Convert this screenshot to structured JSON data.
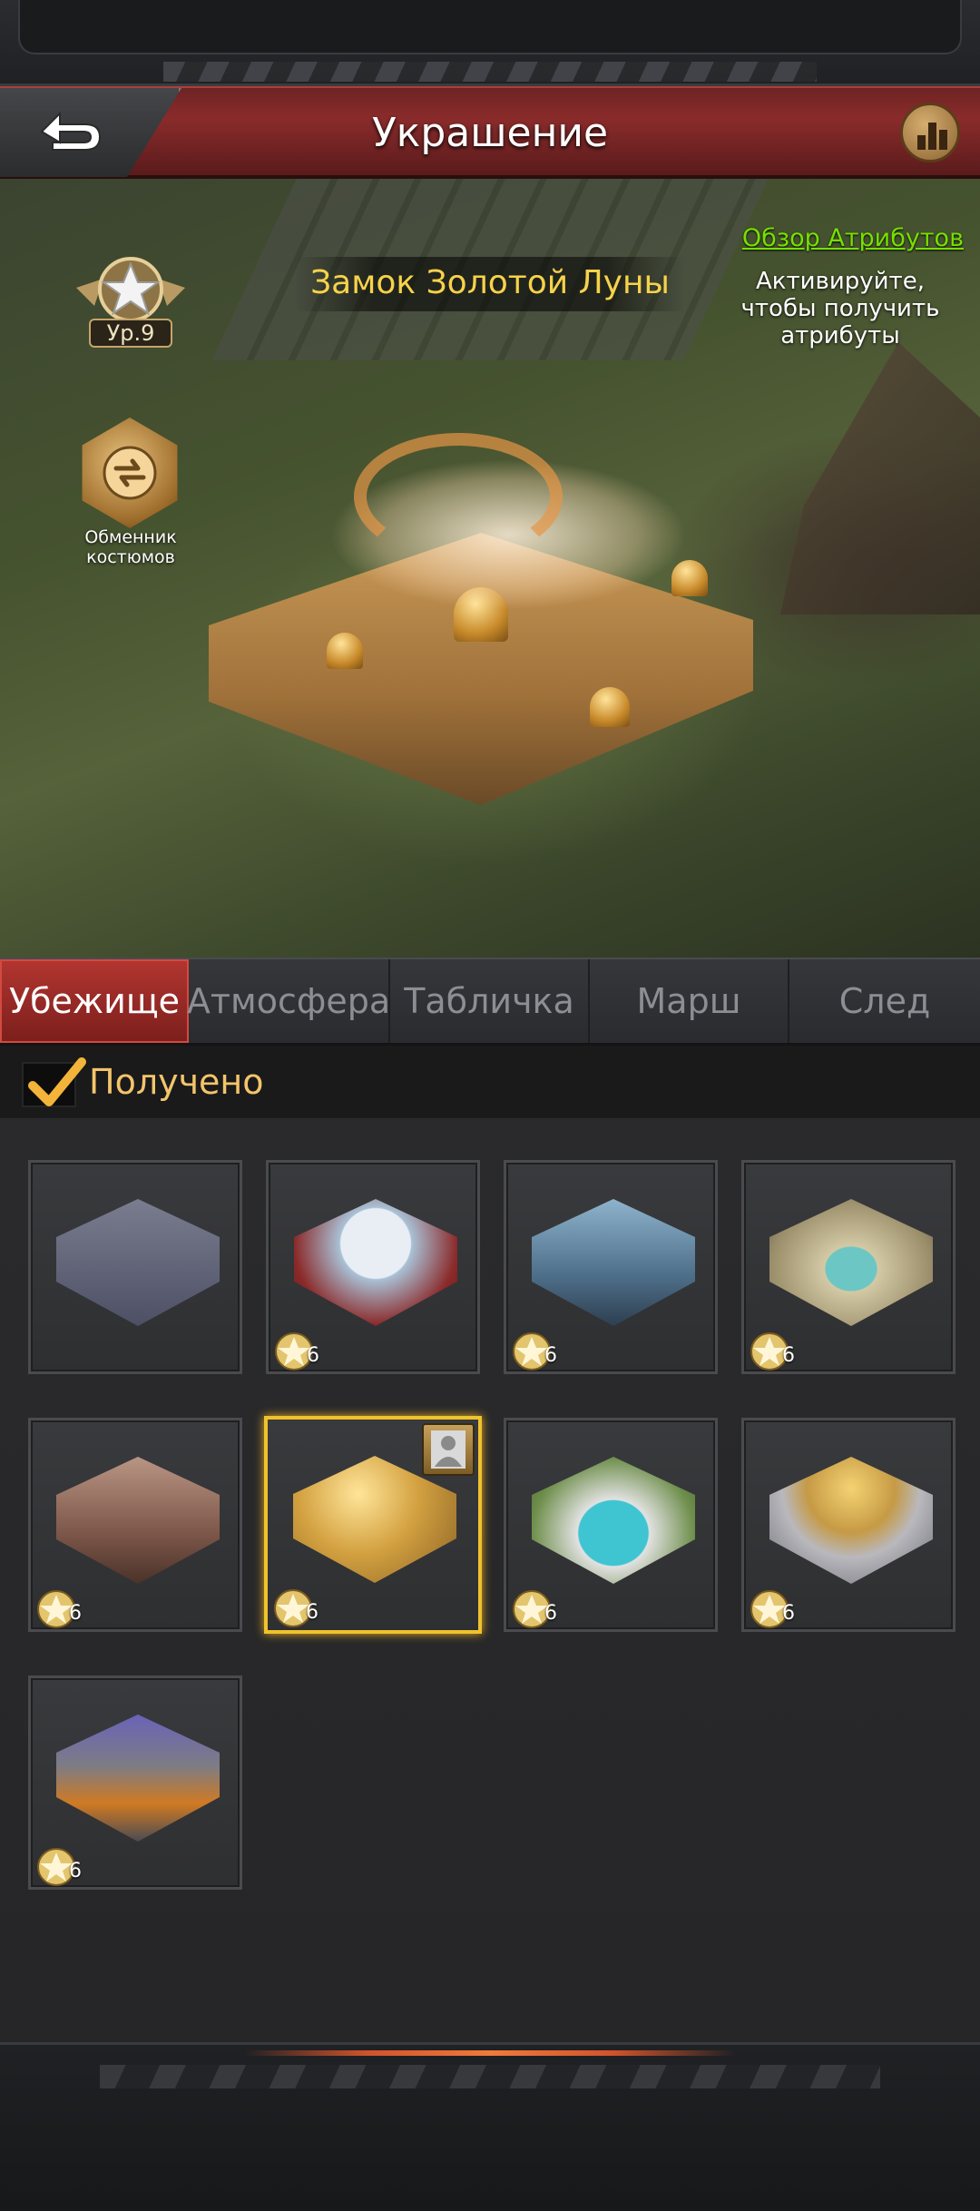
{
  "header": {
    "title": "Украшение",
    "back_icon": "back-arrow-icon",
    "stats_icon": "bar-chart-icon"
  },
  "hero": {
    "decoration_name": "Замок Золотой Луны",
    "level_label": "Ур.9",
    "costume_exchange_label": "Обменник костюмов",
    "attributes_link": "Обзор Атрибутов",
    "activation_hint": "Активируйте, чтобы получить атрибуты"
  },
  "tabs": [
    {
      "label": "Убежище",
      "active": true
    },
    {
      "label": "Атмосфера",
      "active": false
    },
    {
      "label": "Табличка",
      "active": false
    },
    {
      "label": "Марш",
      "active": false
    },
    {
      "label": "След",
      "active": false
    }
  ],
  "filter": {
    "label": "Получено",
    "checked": true
  },
  "items": [
    {
      "level": "",
      "theme": "default-base",
      "selected": false,
      "owner_badge": false
    },
    {
      "level": "6",
      "theme": "snow-globe",
      "selected": false,
      "owner_badge": false
    },
    {
      "level": "6",
      "theme": "blue-tech-city",
      "selected": false,
      "owner_badge": false
    },
    {
      "level": "6",
      "theme": "stadium-city",
      "selected": false,
      "owner_badge": false
    },
    {
      "level": "6",
      "theme": "industrial-red",
      "selected": false,
      "owner_badge": false
    },
    {
      "level": "6",
      "theme": "golden-moon",
      "selected": true,
      "owner_badge": true
    },
    {
      "level": "6",
      "theme": "pool-villa",
      "selected": false,
      "owner_badge": false
    },
    {
      "level": "6",
      "theme": "golden-dome-city",
      "selected": false,
      "owner_badge": false
    },
    {
      "level": "6",
      "theme": "halloween-castle",
      "selected": false,
      "owner_badge": false
    }
  ],
  "colors": {
    "accent_red": "#b23530",
    "gold_text": "#f7d24a",
    "link_green": "#76e000",
    "selected_border": "#f0c22c"
  }
}
